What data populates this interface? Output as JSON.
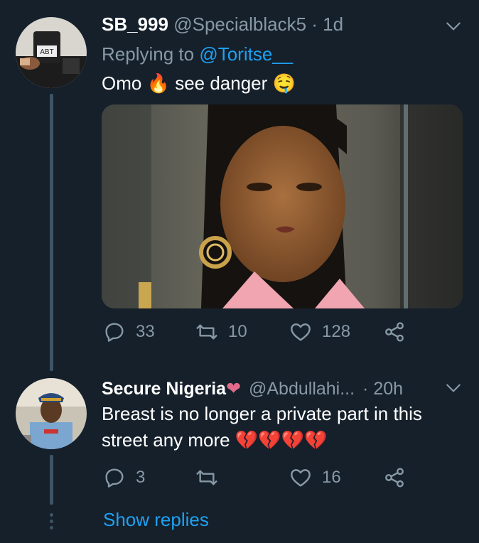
{
  "tweets": [
    {
      "name": "SB_999",
      "handle": "@Specialblack5",
      "separator": "·",
      "time": "1d",
      "replying_prefix": "Replying to",
      "replying_to": "@Toritse__",
      "text_part1": "Omo",
      "text_emoji1": "🔥",
      "text_part2": "see danger",
      "text_emoji2": "🤤",
      "counts": {
        "replies": "33",
        "retweets": "10",
        "likes": "128"
      }
    },
    {
      "name": "Secure Nigeria",
      "name_emoji": "❤",
      "handle": "@Abdullahi...",
      "separator": "·",
      "time": "20h",
      "text_line1": "Breast is no longer a private part in this",
      "text_line2": "street any more",
      "text_emojis": "💔💔💔💔",
      "counts": {
        "replies": "3",
        "retweets": "",
        "likes": "16"
      }
    }
  ],
  "show_replies": "Show replies",
  "colors": {
    "background": "#15202b",
    "secondary_text": "#8899a6",
    "link": "#1da1f2",
    "thread_line": "#3d5466"
  },
  "icons": [
    "chevron-down-icon",
    "reply-icon",
    "retweet-icon",
    "like-icon",
    "share-icon"
  ]
}
